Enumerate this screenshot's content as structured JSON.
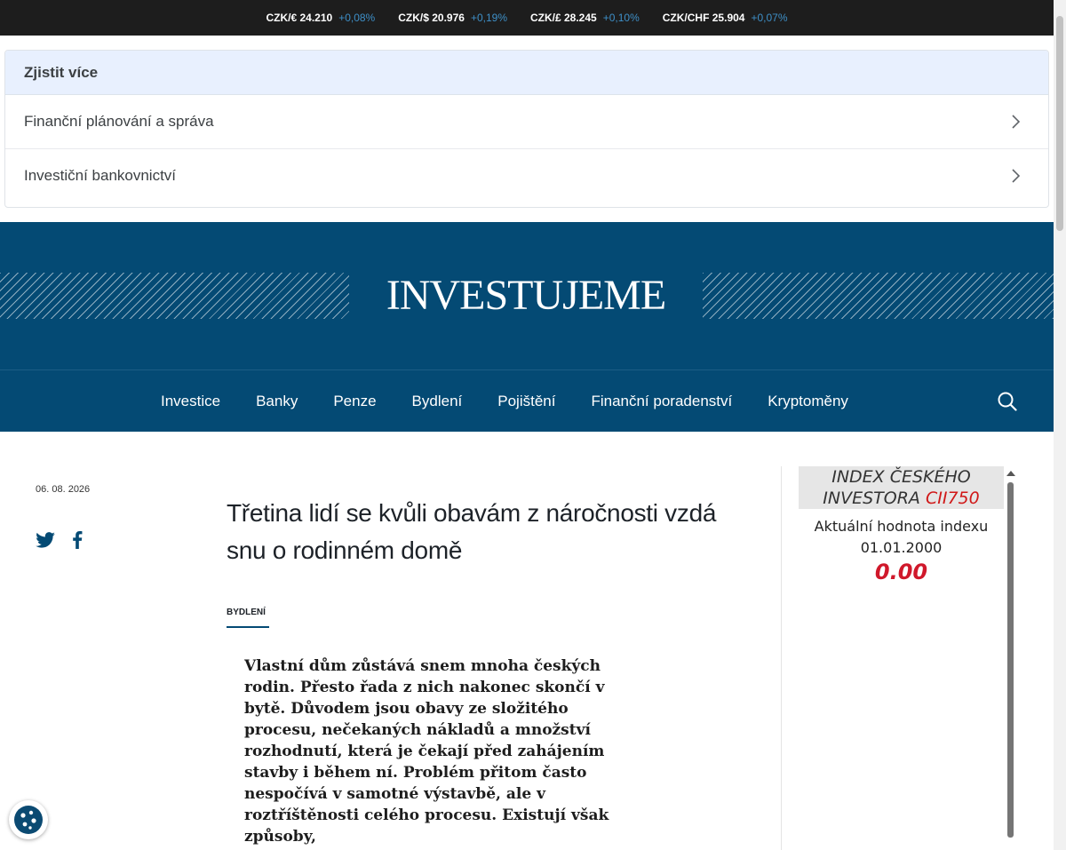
{
  "ticker": [
    {
      "pair": "CZK/€ 24.210",
      "change": "+0,08%"
    },
    {
      "pair": "CZK/$ 20.976",
      "change": "+0,19%"
    },
    {
      "pair": "CZK/£ 28.245",
      "change": "+0,10%"
    },
    {
      "pair": "CZK/CHF 25.904",
      "change": "+0,07%"
    }
  ],
  "learn_more": {
    "heading": "Zjistit více",
    "items": [
      {
        "label": "Finanční plánování a správa"
      },
      {
        "label": "Investiční bankovnictví"
      }
    ]
  },
  "brand": {
    "logo": "INVESTUJEME"
  },
  "nav": {
    "items": [
      "Investice",
      "Banky",
      "Penze",
      "Bydlení",
      "Pojištění",
      "Finanční poradenství",
      "Kryptoměny"
    ]
  },
  "article": {
    "date": "06. 08. 2026",
    "title": "Třetina lidí se kvůli obavám z náročnosti vzdá snu o rodinném domě",
    "category": "BYDLENÍ",
    "lead": "Vlastní dům zůstává snem mnoha českých rodin. Přesto řada z nich nakonec skončí v bytě. Důvodem jsou obavy ze složitého procesu, nečekaných nákladů a množství rozhodnutí, která je čekají před zahájením stavby i během ní. Problém přitom často nespočívá v samotné výstavbě, ale v roztříštěnosti celého procesu. Existují však způsoby,"
  },
  "sidebar": {
    "index_title": "INDEX ČESKÉHO INVESTORA",
    "index_code": "CII750",
    "index_label": "Aktuální hodnota indexu",
    "index_date": "01.01.2000",
    "index_value": "0.00"
  },
  "colors": {
    "brand_blue": "#044a74",
    "ticker_change": "#3e8fc7",
    "index_red": "#d0182b"
  }
}
